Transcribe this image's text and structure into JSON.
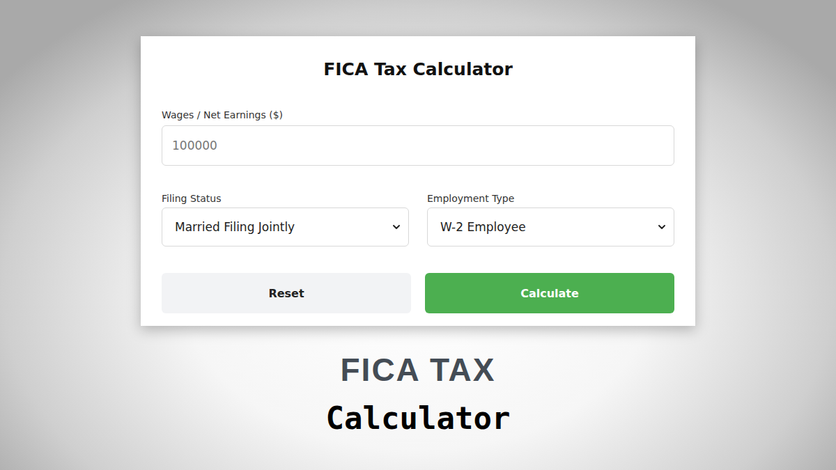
{
  "card": {
    "title": "FICA Tax Calculator",
    "wages": {
      "label": "Wages / Net Earnings ($)",
      "placeholder": "100000"
    },
    "selects": [
      {
        "label": "Filing Status",
        "value": "Married Filing Jointly"
      },
      {
        "label": "Employment Type",
        "value": "W-2 Employee"
      }
    ],
    "buttons": [
      {
        "label": "Reset",
        "kind": "secondary"
      },
      {
        "label": "Calculate",
        "kind": "primary"
      }
    ]
  },
  "caption": {
    "line1": "FICA TAX",
    "line2": "Calculator"
  }
}
